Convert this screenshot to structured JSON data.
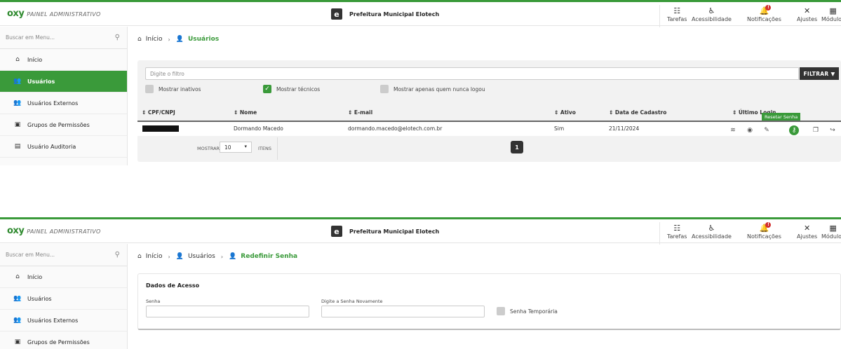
{
  "brand": {
    "logo": "oxy",
    "subtitle": "PAINEL ADMINISTRATIVO"
  },
  "center": {
    "logo_letter": "e",
    "title": "Prefeitura Municipal Elotech"
  },
  "top_actions": [
    {
      "label": "Tarefas",
      "icon": "tasks-icon"
    },
    {
      "label": "Acessibilidade",
      "icon": "accessibility-icon"
    },
    {
      "label": "Notificações",
      "icon": "bell-icon",
      "badge": "!"
    },
    {
      "label": "Ajustes",
      "icon": "tools-icon"
    },
    {
      "label": "Módulos",
      "icon": "grid-icon"
    }
  ],
  "search": {
    "placeholder": "Buscar em Menu..."
  },
  "menu_top": [
    {
      "label": "Início",
      "icon": "home-icon"
    },
    {
      "label": "Usuários",
      "icon": "users-icon",
      "active": true
    },
    {
      "label": "Usuários Externos",
      "icon": "users-icon"
    },
    {
      "label": "Grupos de Permissões",
      "icon": "clipboard-icon"
    },
    {
      "label": "Usuário Auditoria",
      "icon": "document-icon"
    }
  ],
  "menu_bottom": [
    {
      "label": "Início",
      "icon": "home-icon"
    },
    {
      "label": "Usuários",
      "icon": "users-icon"
    },
    {
      "label": "Usuários Externos",
      "icon": "users-icon"
    },
    {
      "label": "Grupos de Permissões",
      "icon": "clipboard-icon"
    }
  ],
  "breadcrumb_top": {
    "home": "Início",
    "current": "Usuários"
  },
  "breadcrumb_bottom": {
    "home": "Início",
    "mid": "Usuários",
    "current": "Redefinir Senha"
  },
  "filter": {
    "placeholder": "Digite o filtro",
    "button": "FILTRAR",
    "checkboxes": [
      {
        "label": "Mostrar inativos",
        "checked": false
      },
      {
        "label": "Mostrar técnicos",
        "checked": true
      },
      {
        "label": "Mostrar apenas quem nunca logou",
        "checked": false
      }
    ]
  },
  "table": {
    "headers": [
      "CPF/CNPJ",
      "Nome",
      "E-mail",
      "Ativo",
      "Data de Cadastro",
      "Último Login"
    ],
    "rows": [
      {
        "cpf": "",
        "nome": "Dormando Macedo",
        "email": "dormando.macedo@elotech.com.br",
        "ativo": "Sim",
        "cadastro": "21/11/2024"
      }
    ],
    "tooltip": "Resetar Senha"
  },
  "pager": {
    "show_label": "MOSTRAR",
    "per_page": "10",
    "items_label": "ITENS",
    "current_page": "1"
  },
  "access_form": {
    "title": "Dados de Acesso",
    "password_label": "Senha",
    "password_repeat_label": "Digite a Senha Novamente",
    "temp_label": "Senha Temporária"
  }
}
